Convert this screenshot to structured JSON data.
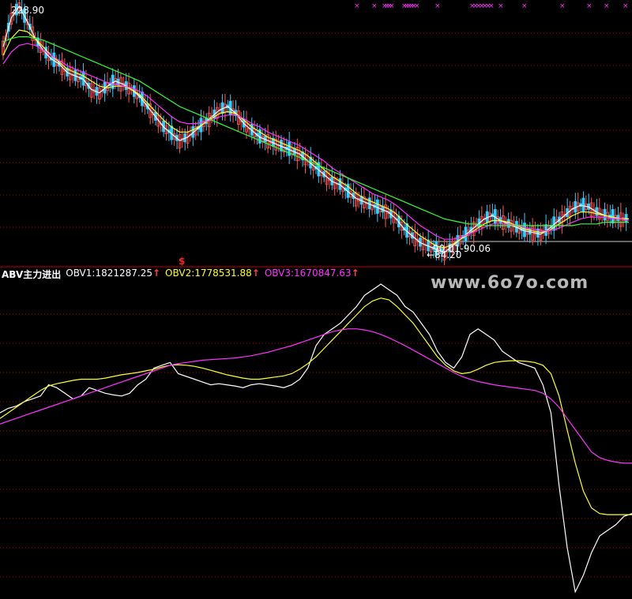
{
  "upper_panel": {
    "high_label": "228.90",
    "low_label": "←84.20",
    "date_range": "90.01-90.06",
    "marker": "$"
  },
  "lower_panel": {
    "indicator_name": "ABV主力进出",
    "obv1_label": "OBV1:1821287.25",
    "obv2_label": "OBV2:1778531.88",
    "obv3_label": "OBV3:1670847.63",
    "arrow_glyph": "↑"
  },
  "watermark": "www.6o7o.com",
  "colors": {
    "background": "#000000",
    "grid": "#b40000",
    "divider": "#c00000",
    "up_candle": "#ff5555",
    "down_candle": "#33ccff",
    "price_line": "#ffffff",
    "ma_short": "#ffff33",
    "ma_mid": "#ff33ff",
    "ma_long": "#33ff33",
    "obv1": "#ffffff",
    "obv2": "#ffff33",
    "obv3": "#ff33ff",
    "top_markers": "#ff33ff"
  },
  "chart_data": [
    {
      "type": "line",
      "panel": "price",
      "ylim": [
        84.2,
        228.9
      ],
      "series": [
        {
          "values": [
            205,
            222,
            228.9,
            220,
            210,
            203,
            198,
            195,
            190,
            188,
            186,
            180,
            178,
            182,
            185,
            183,
            180,
            176,
            170,
            164,
            158,
            154,
            150,
            152,
            156,
            160,
            164,
            168,
            170,
            166,
            160,
            156,
            152,
            150,
            148,
            146,
            144,
            142,
            138,
            134,
            130,
            126,
            124,
            120,
            116,
            114,
            112,
            110,
            108,
            104,
            98,
            94,
            90,
            88,
            86,
            84.2,
            88,
            92,
            96,
            100,
            104,
            106,
            103,
            101,
            99,
            97,
            96,
            95,
            98,
            102,
            106,
            110,
            112,
            111,
            108,
            106,
            105,
            104,
            104
          ]
        },
        {
          "values": [
            200,
            210,
            215,
            214,
            210,
            205,
            200,
            196,
            192,
            190,
            188,
            185,
            182,
            181,
            182,
            182,
            180,
            177,
            172,
            167,
            162,
            158,
            155,
            155,
            157,
            160,
            163,
            166,
            167,
            166,
            162,
            158,
            155,
            152,
            150,
            148,
            146,
            144,
            141,
            137,
            133,
            129,
            126,
            123,
            119,
            116,
            114,
            112,
            110,
            107,
            102,
            98,
            94,
            91,
            88,
            87,
            89,
            92,
            95,
            98,
            101,
            103,
            103,
            102,
            100,
            98,
            97,
            96,
            97,
            100,
            103,
            106,
            108,
            108,
            107,
            106,
            105,
            104,
            104
          ]
        },
        {
          "values": [
            195,
            202,
            206,
            207,
            206,
            203,
            200,
            197,
            194,
            192,
            190,
            188,
            186,
            184,
            183,
            182,
            181,
            179,
            176,
            172,
            168,
            164,
            161,
            160,
            160,
            161,
            162,
            164,
            165,
            165,
            163,
            160,
            158,
            155,
            153,
            151,
            149,
            147,
            144,
            141,
            138,
            134,
            131,
            128,
            125,
            122,
            119,
            117,
            115,
            112,
            108,
            104,
            100,
            97,
            94,
            92,
            92,
            93,
            95,
            97,
            99,
            101,
            101,
            101,
            100,
            99,
            98,
            97,
            97,
            98,
            100,
            102,
            104,
            105,
            105,
            105,
            104,
            104,
            103
          ]
        },
        {
          "values": [
            208,
            210,
            211,
            211,
            210,
            209,
            207,
            205,
            203,
            201,
            199,
            197,
            195,
            193,
            191,
            189,
            187,
            185,
            182,
            179,
            176,
            173,
            170,
            168,
            166,
            164,
            162,
            160,
            158,
            156,
            154,
            152,
            150,
            148,
            146,
            144,
            142,
            140,
            138,
            136,
            134,
            132,
            130,
            128,
            126,
            124,
            122,
            120,
            118,
            116,
            114,
            112,
            110,
            108,
            106,
            104,
            103,
            102,
            101,
            101,
            100,
            100,
            100,
            100,
            100,
            100,
            100,
            100,
            100,
            100,
            100,
            100,
            101,
            101,
            101,
            102,
            102,
            102,
            102
          ]
        }
      ]
    },
    {
      "type": "line",
      "panel": "indicator",
      "series": [
        {
          "name": "OBV1",
          "values": [
            10,
            18,
            22,
            30,
            35,
            40,
            60,
            55,
            45,
            35,
            40,
            55,
            50,
            45,
            42,
            40,
            45,
            60,
            70,
            90,
            95,
            100,
            80,
            75,
            70,
            65,
            60,
            62,
            60,
            58,
            55,
            60,
            62,
            60,
            58,
            55,
            60,
            70,
            90,
            130,
            150,
            160,
            170,
            185,
            200,
            220,
            230,
            240,
            230,
            220,
            200,
            190,
            170,
            150,
            120,
            100,
            90,
            110,
            150,
            160,
            150,
            140,
            120,
            110,
            100,
            95,
            90,
            60,
            10,
            -120,
            -230,
            -310,
            -280,
            -240,
            -210,
            -200,
            -190,
            -175,
            -170
          ]
        },
        {
          "name": "OBV2",
          "values": [
            0,
            10,
            20,
            30,
            40,
            50,
            58,
            62,
            65,
            68,
            70,
            70,
            70,
            72,
            75,
            78,
            80,
            82,
            85,
            88,
            92,
            95,
            96,
            95,
            93,
            90,
            86,
            82,
            78,
            75,
            72,
            70,
            70,
            72,
            74,
            76,
            80,
            88,
            98,
            110,
            125,
            140,
            155,
            170,
            185,
            200,
            210,
            215,
            212,
            200,
            185,
            170,
            150,
            130,
            110,
            95,
            85,
            80,
            82,
            88,
            95,
            100,
            102,
            103,
            103,
            102,
            100,
            95,
            80,
            40,
            -20,
            -80,
            -130,
            -160,
            -170,
            -172,
            -172,
            -172,
            -172
          ]
        },
        {
          "name": "OBV3",
          "values": [
            -10,
            -5,
            0,
            5,
            10,
            15,
            20,
            25,
            30,
            35,
            40,
            45,
            50,
            55,
            60,
            65,
            70,
            75,
            80,
            85,
            90,
            95,
            98,
            100,
            102,
            104,
            105,
            106,
            107,
            108,
            110,
            112,
            115,
            118,
            122,
            126,
            130,
            135,
            140,
            145,
            150,
            155,
            158,
            160,
            160,
            158,
            155,
            150,
            144,
            137,
            130,
            122,
            114,
            106,
            98,
            90,
            82,
            75,
            70,
            66,
            63,
            60,
            58,
            56,
            54,
            52,
            50,
            45,
            35,
            20,
            0,
            -20,
            -40,
            -60,
            -70,
            -75,
            -78,
            -80,
            -80
          ]
        }
      ]
    }
  ]
}
